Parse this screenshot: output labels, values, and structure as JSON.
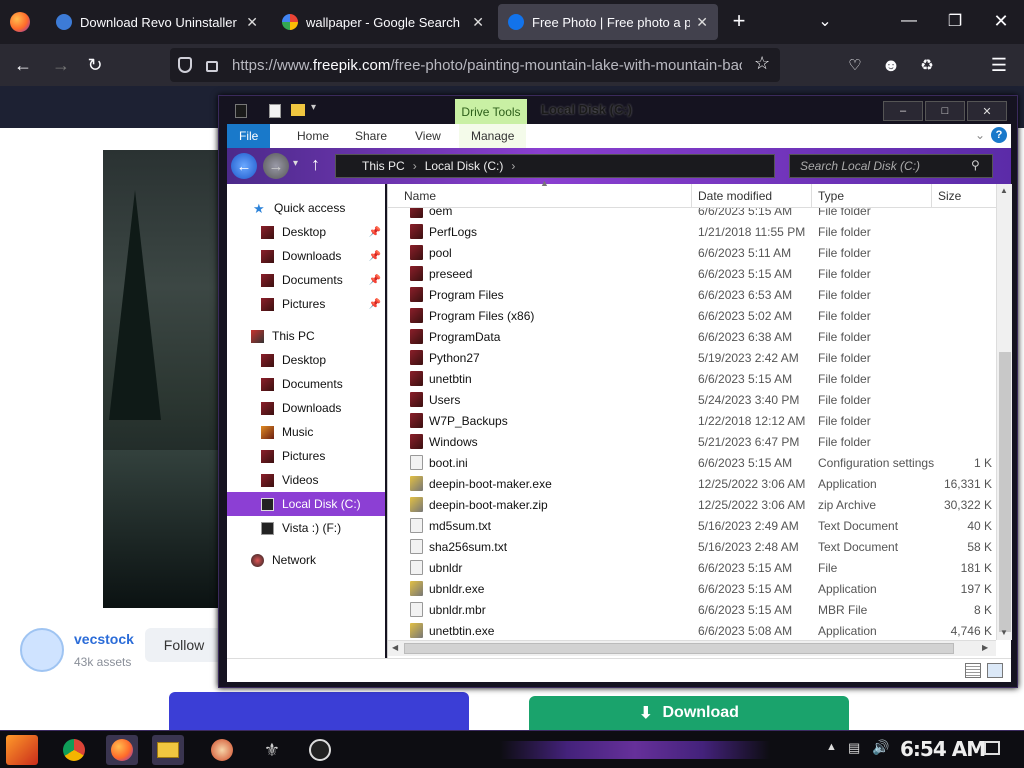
{
  "browser": {
    "tabs": [
      {
        "title": "Download Revo Uninstaller Fr",
        "close": "✕"
      },
      {
        "title": "wallpaper - Google Search",
        "close": "✕"
      },
      {
        "title": "Free Photo | Free photo a pai",
        "close": "✕"
      }
    ],
    "new_tab": "+",
    "url_prefix": "https://www.",
    "url_domain": "freepik.com",
    "url_path": "/free-photo/painting-mountain-lake-with-mountain-bac"
  },
  "page": {
    "author": "vecstock",
    "assets": "43k assets",
    "follow": "Follow",
    "download": "Download"
  },
  "explorer": {
    "window_title": "Local Disk (C:)",
    "drive_tools": "Drive Tools",
    "ribbon_tabs": [
      "File",
      "Home",
      "Share",
      "View",
      "Manage"
    ],
    "breadcrumb": [
      "This PC",
      "Local Disk (C:)"
    ],
    "search_placeholder": "Search Local Disk (C:)",
    "nav": [
      {
        "label": "Quick access"
      },
      {
        "label": "Desktop"
      },
      {
        "label": "Downloads"
      },
      {
        "label": "Documents"
      },
      {
        "label": "Pictures"
      },
      {
        "label": "This PC"
      },
      {
        "label": "Desktop"
      },
      {
        "label": "Documents"
      },
      {
        "label": "Downloads"
      },
      {
        "label": "Music"
      },
      {
        "label": "Pictures"
      },
      {
        "label": "Videos"
      },
      {
        "label": "Local Disk (C:)"
      },
      {
        "label": "Vista :) (F:)"
      },
      {
        "label": "Network"
      }
    ],
    "columns": [
      "Name",
      "Date modified",
      "Type",
      "Size"
    ],
    "files": [
      {
        "name": "oem",
        "date": "6/6/2023 5:15 AM",
        "type": "File folder",
        "size": ""
      },
      {
        "name": "PerfLogs",
        "date": "1/21/2018 11:55 PM",
        "type": "File folder",
        "size": ""
      },
      {
        "name": "pool",
        "date": "6/6/2023 5:11 AM",
        "type": "File folder",
        "size": ""
      },
      {
        "name": "preseed",
        "date": "6/6/2023 5:15 AM",
        "type": "File folder",
        "size": ""
      },
      {
        "name": "Program Files",
        "date": "6/6/2023 6:53 AM",
        "type": "File folder",
        "size": ""
      },
      {
        "name": "Program Files (x86)",
        "date": "6/6/2023 5:02 AM",
        "type": "File folder",
        "size": ""
      },
      {
        "name": "ProgramData",
        "date": "6/6/2023 6:38 AM",
        "type": "File folder",
        "size": ""
      },
      {
        "name": "Python27",
        "date": "5/19/2023 2:42 AM",
        "type": "File folder",
        "size": ""
      },
      {
        "name": "unetbtin",
        "date": "6/6/2023 5:15 AM",
        "type": "File folder",
        "size": ""
      },
      {
        "name": "Users",
        "date": "5/24/2023 3:40 PM",
        "type": "File folder",
        "size": ""
      },
      {
        "name": "W7P_Backups",
        "date": "1/22/2018 12:12 AM",
        "type": "File folder",
        "size": ""
      },
      {
        "name": "Windows",
        "date": "5/21/2023 6:47 PM",
        "type": "File folder",
        "size": ""
      },
      {
        "name": "boot.ini",
        "date": "6/6/2023 5:15 AM",
        "type": "Configuration settings",
        "size": "1 K"
      },
      {
        "name": "deepin-boot-maker.exe",
        "date": "12/25/2022 3:06 AM",
        "type": "Application",
        "size": "16,331 K"
      },
      {
        "name": "deepin-boot-maker.zip",
        "date": "12/25/2022 3:06 AM",
        "type": "zip Archive",
        "size": "30,322 K"
      },
      {
        "name": "md5sum.txt",
        "date": "5/16/2023 2:49 AM",
        "type": "Text Document",
        "size": "40 K"
      },
      {
        "name": "sha256sum.txt",
        "date": "5/16/2023 2:48 AM",
        "type": "Text Document",
        "size": "58 K"
      },
      {
        "name": "ubnldr",
        "date": "6/6/2023 5:15 AM",
        "type": "File",
        "size": "181 K"
      },
      {
        "name": "ubnldr.exe",
        "date": "6/6/2023 5:15 AM",
        "type": "Application",
        "size": "197 K"
      },
      {
        "name": "ubnldr.mbr",
        "date": "6/6/2023 5:15 AM",
        "type": "MBR File",
        "size": "8 K"
      },
      {
        "name": "unetbtin.exe",
        "date": "6/6/2023 5:08 AM",
        "type": "Application",
        "size": "4,746 K"
      }
    ]
  },
  "taskbar": {
    "clock": "6:54 AM"
  },
  "colors": {
    "accent": "#8c3fd4",
    "file_tab": "#1979ca",
    "drive_tools": "#c9f0a4",
    "download": "#1aa36c"
  }
}
